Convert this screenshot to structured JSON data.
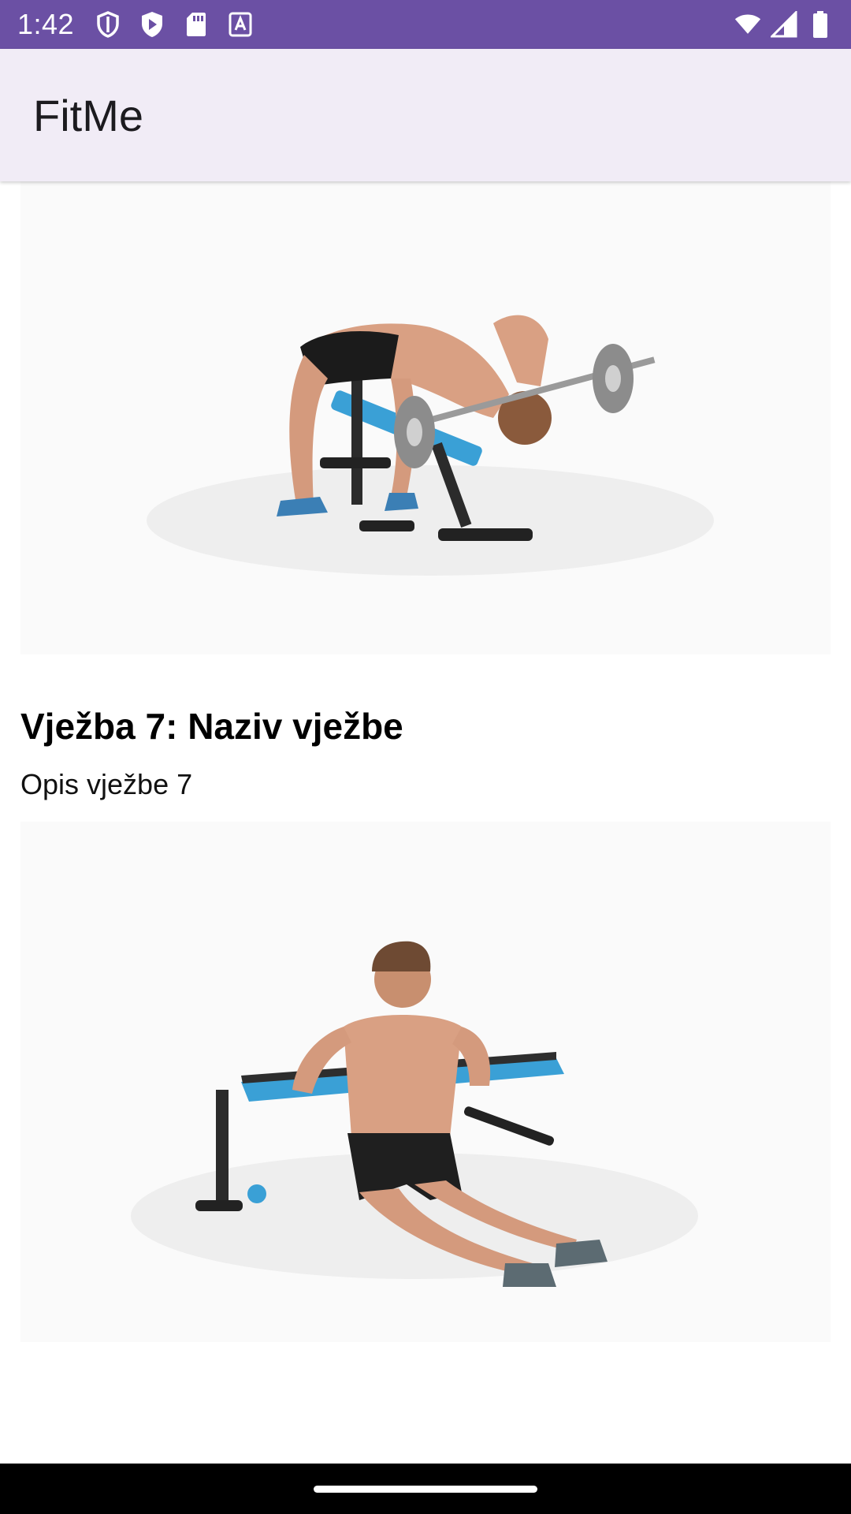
{
  "status_bar": {
    "time": "1:42",
    "left_icons": [
      "shield-icon",
      "play-protect-icon",
      "sd-card-icon",
      "text-a-icon"
    ],
    "right_icons": [
      "wifi-icon",
      "signal-icon",
      "battery-icon"
    ],
    "color": "#6b50a4"
  },
  "app_bar": {
    "title": "FitMe",
    "background": "#f1ecf6"
  },
  "exercises": [
    {
      "title": "Vježba 7: Naziv vježbe",
      "description": "Opis vježbe 7",
      "image": "lying-triceps-extension-illustration"
    },
    {
      "image": "bench-dips-illustration"
    }
  ]
}
